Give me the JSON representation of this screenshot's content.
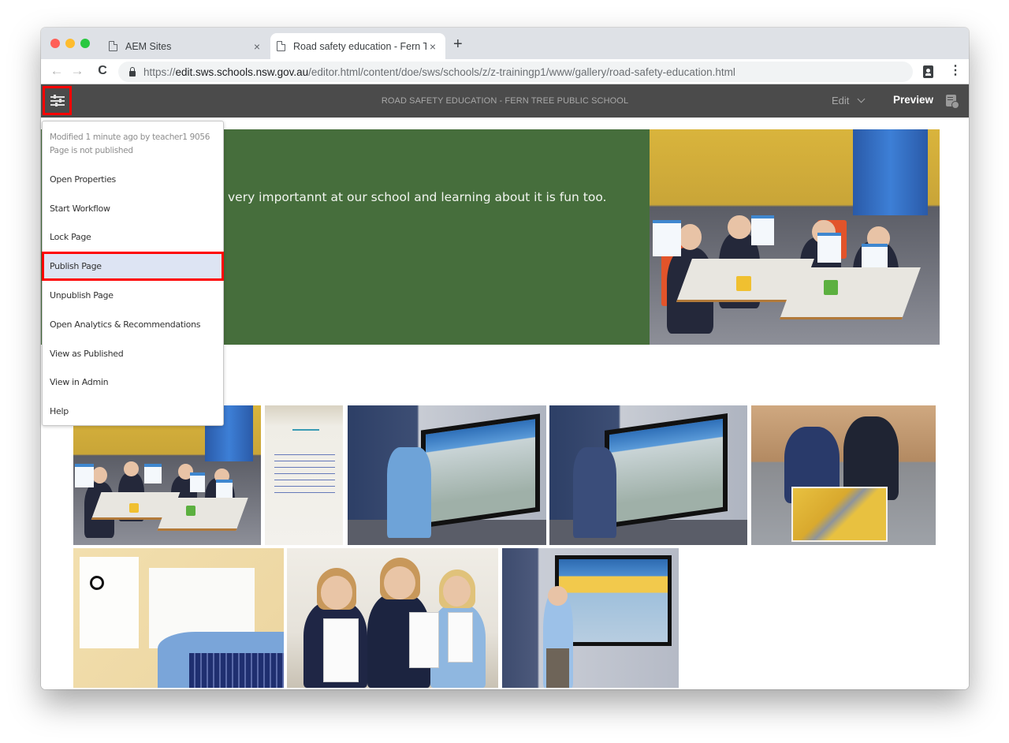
{
  "browser": {
    "tabs": [
      {
        "title": "AEM Sites",
        "active": false
      },
      {
        "title": "Road safety education - Fern T",
        "active": true
      }
    ],
    "new_tab_icon": "+",
    "close_icon": "×",
    "nav": {
      "back_icon": "←",
      "forward_icon": "→",
      "reload_icon": "C"
    },
    "url": {
      "scheme": "https://",
      "host": "edit.sws.schools.nsw.gov.au",
      "path": "/editor.html/content/doe/sws/schools/z/z-trainingp1/www/gallery/road-safety-education.html"
    },
    "menu_icon": "⋮"
  },
  "aem_toolbar": {
    "page_title": "ROAD SAFETY EDUCATION - FERN TREE PUBLIC SCHOOL",
    "mode_selected": "Edit",
    "preview_label": "Preview",
    "highlight_color": "#ff0000"
  },
  "page_info_menu": {
    "meta": {
      "modified": "Modified 1 minute ago by teacher1 9056",
      "status": "Page is not published"
    },
    "items": [
      {
        "label": "Open Properties",
        "highlighted": false
      },
      {
        "label": "Start Workflow",
        "highlighted": false
      },
      {
        "label": "Lock Page",
        "highlighted": false
      },
      {
        "label": "Publish Page",
        "highlighted": true
      },
      {
        "label": "Unpublish Page",
        "highlighted": false
      },
      {
        "label": "Open Analytics & Recommendations",
        "highlighted": false
      },
      {
        "label": "View as Published",
        "highlighted": false
      },
      {
        "label": "View in Admin",
        "highlighted": false
      },
      {
        "label": "Help",
        "highlighted": false
      }
    ]
  },
  "page": {
    "hero": {
      "text": "very importannt at our school and learning about it is fun too.",
      "background_color": "#466e3c",
      "image": "classroom-students-holding-worksheets"
    },
    "gallery": [
      {
        "subject": "classroom-students-thumbs-up"
      },
      {
        "subject": "road-safety-poster"
      },
      {
        "subject": "boy-at-interactive-whiteboard"
      },
      {
        "subject": "girl-at-interactive-whiteboard"
      },
      {
        "subject": "two-students-with-road-map"
      },
      {
        "subject": "holding-hands-worksheet"
      },
      {
        "subject": "three-students-with-worksheets"
      },
      {
        "subject": "boy-beside-whiteboard"
      }
    ]
  }
}
